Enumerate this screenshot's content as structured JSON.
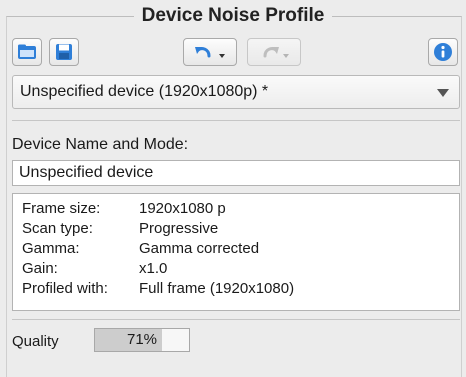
{
  "panel": {
    "title": "Device Noise Profile"
  },
  "toolbar": {
    "open_icon": "folder-icon",
    "save_icon": "floppy-disk-icon",
    "undo_icon": "undo-arrow-icon",
    "redo_icon": "redo-arrow-icon",
    "info_icon": "info-icon",
    "redo_disabled": true
  },
  "device_select": {
    "selected": "Unspecified device (1920x1080p) *"
  },
  "device_name": {
    "label": "Device Name and Mode:",
    "value": "Unspecified device"
  },
  "device_info": [
    {
      "key": "Frame size:",
      "value": "1920x1080 p"
    },
    {
      "key": "Scan type:",
      "value": "Progressive"
    },
    {
      "key": "Gamma:",
      "value": "Gamma corrected"
    },
    {
      "key": "Gain:",
      "value": "x1.0"
    },
    {
      "key": "Profiled with:",
      "value": "Full frame (1920x1080)"
    }
  ],
  "quality": {
    "label": "Quality",
    "text": "71%",
    "percent": 71
  },
  "colors": {
    "accent": "#2f7fd8",
    "background": "#ececec"
  }
}
